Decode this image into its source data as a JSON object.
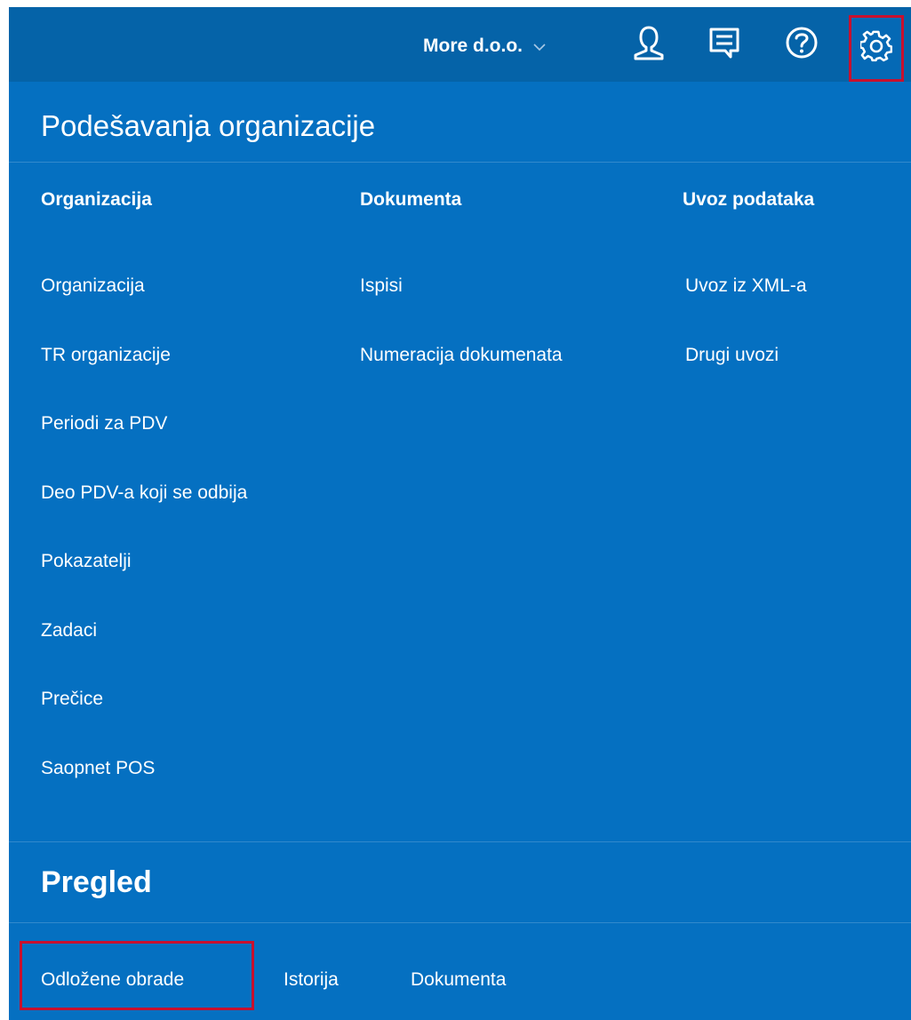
{
  "topbar": {
    "company_name": "More d.o.o.",
    "icons": [
      "user-icon",
      "messages-icon",
      "help-icon",
      "gear-icon"
    ]
  },
  "settings": {
    "title": "Podešavanja organizacije",
    "columns": [
      {
        "heading": "Organizacija",
        "items": [
          "Organizacija",
          "TR organizacije",
          "Periodi za PDV",
          "Deo PDV-a koji se odbija",
          "Pokazatelji",
          "Zadaci",
          "Prečice",
          "Saopnet POS"
        ]
      },
      {
        "heading": "Dokumenta",
        "items": [
          "Ispisi",
          "Numeracija dokumenata"
        ]
      },
      {
        "heading": "Uvoz podataka",
        "items": [
          "Uvoz iz XML-a",
          "Drugi uvozi"
        ]
      }
    ]
  },
  "overview": {
    "title": "Pregled",
    "items": [
      "Odložene obrade",
      "Istorija",
      "Dokumenta"
    ]
  },
  "colors": {
    "panel_background": "#0570c1",
    "topbar_background": "#0563a8",
    "highlight_border": "#c8102e",
    "text": "#ffffff"
  }
}
